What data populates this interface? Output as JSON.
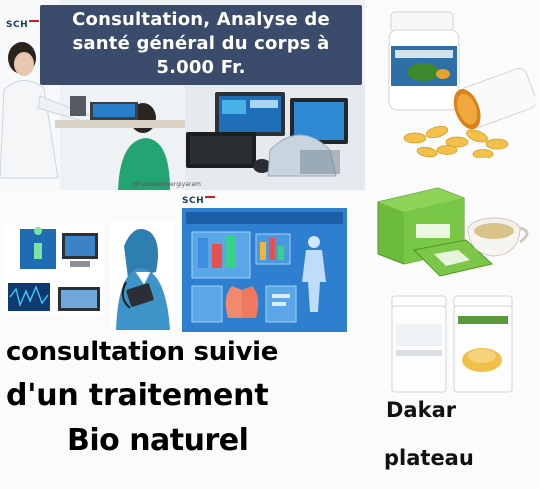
{
  "top_left": {
    "logo": "SCH",
    "banner": "Consultation, Analyse de\nsanté général du corps à\n5.000 Fr.",
    "watermark": "@haoqisenwergiyaram"
  },
  "middle": {
    "logo": "SCH"
  },
  "headline": {
    "line1": "consultation suivie",
    "line2": "d'un traitement",
    "line3": "Bio naturel"
  },
  "location": {
    "line1": "Dakar",
    "line2": "plateau"
  },
  "colors": {
    "banner_bg": "#3b4b6c",
    "software_blue": "#2f7fd0"
  }
}
